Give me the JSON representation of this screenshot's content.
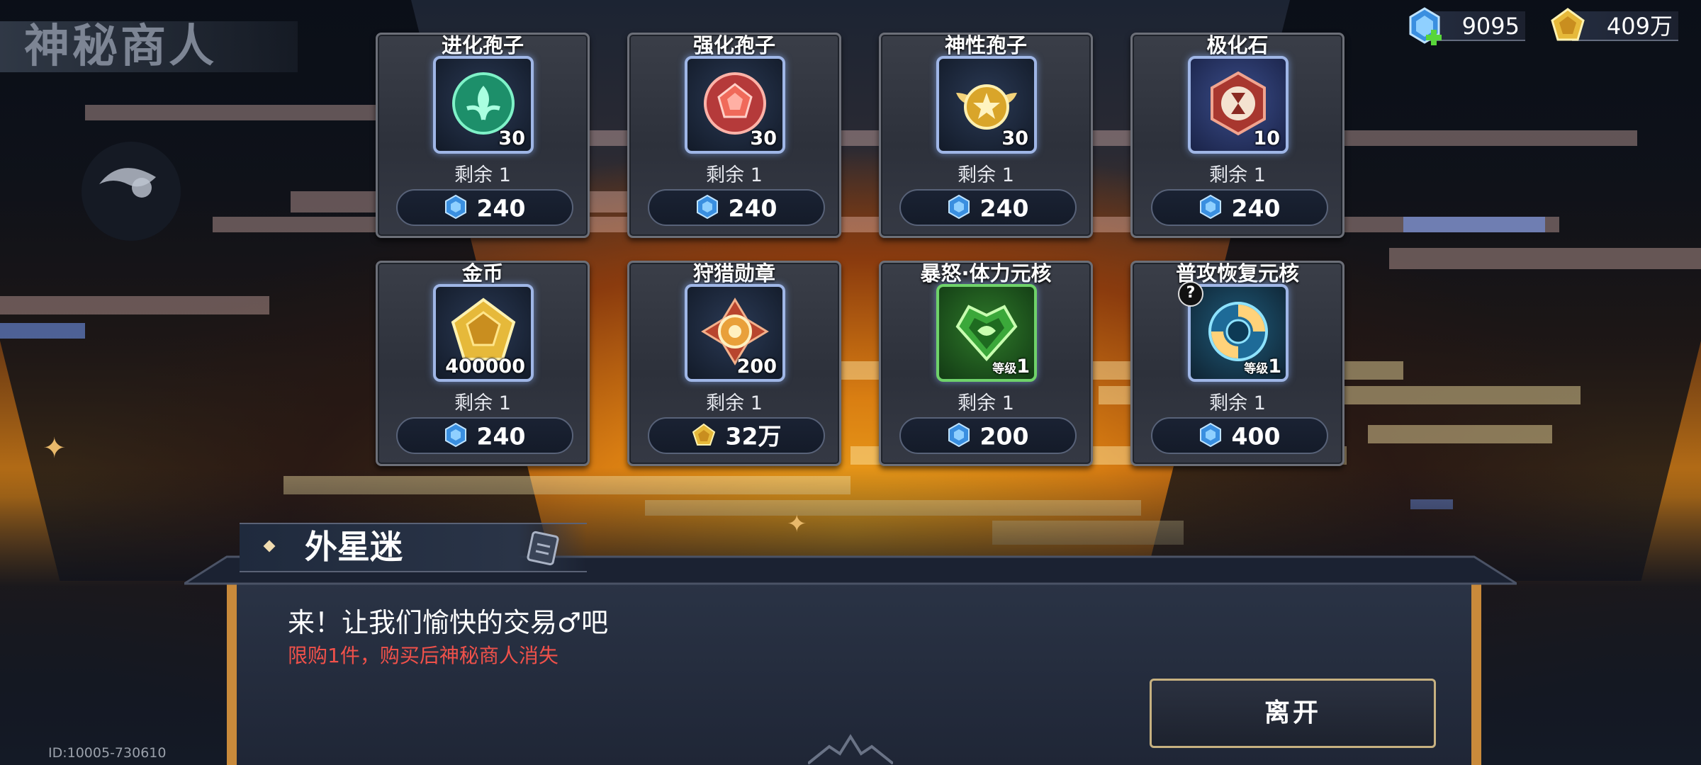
{
  "title": "神秘商人",
  "currency": {
    "gems": "9095",
    "gold": "409万"
  },
  "shop": {
    "items": [
      {
        "name": "进化孢子",
        "qty": "30",
        "remain": "剩余 1",
        "price": "240",
        "price_currency": "gem"
      },
      {
        "name": "强化孢子",
        "qty": "30",
        "remain": "剩余 1",
        "price": "240",
        "price_currency": "gem"
      },
      {
        "name": "神性孢子",
        "qty": "30",
        "remain": "剩余 1",
        "price": "240",
        "price_currency": "gem"
      },
      {
        "name": "极化石",
        "qty": "10",
        "remain": "剩余 1",
        "price": "240",
        "price_currency": "gem"
      },
      {
        "name": "金币",
        "qty": "400000",
        "remain": "剩余 1",
        "price": "240",
        "price_currency": "gem"
      },
      {
        "name": "狩猎勋章",
        "qty": "200",
        "remain": "剩余 1",
        "price": "32万",
        "price_currency": "gold"
      },
      {
        "name": "暴怒·体力元核",
        "level_label": "等级",
        "level": "1",
        "remain": "剩余 1",
        "price": "200",
        "price_currency": "gem"
      },
      {
        "name": "普攻恢复元核",
        "level_label": "等级",
        "level": "1",
        "remain": "剩余 1",
        "price": "400",
        "price_currency": "gem",
        "help": "?"
      }
    ]
  },
  "dialog": {
    "npc_name": "外星迷",
    "speech": "来！让我们愉快的交易♂吧",
    "notice": "限购1件，购买后神秘商人消失",
    "leave_label": "离开"
  },
  "footer": {
    "id_text": "ID:10005-730610"
  },
  "icons": {
    "gem": "blue-gem-icon",
    "gold": "gold-coin-icon"
  },
  "colors": {
    "notice": "#f0514a",
    "leave_border": "#c7b180"
  }
}
